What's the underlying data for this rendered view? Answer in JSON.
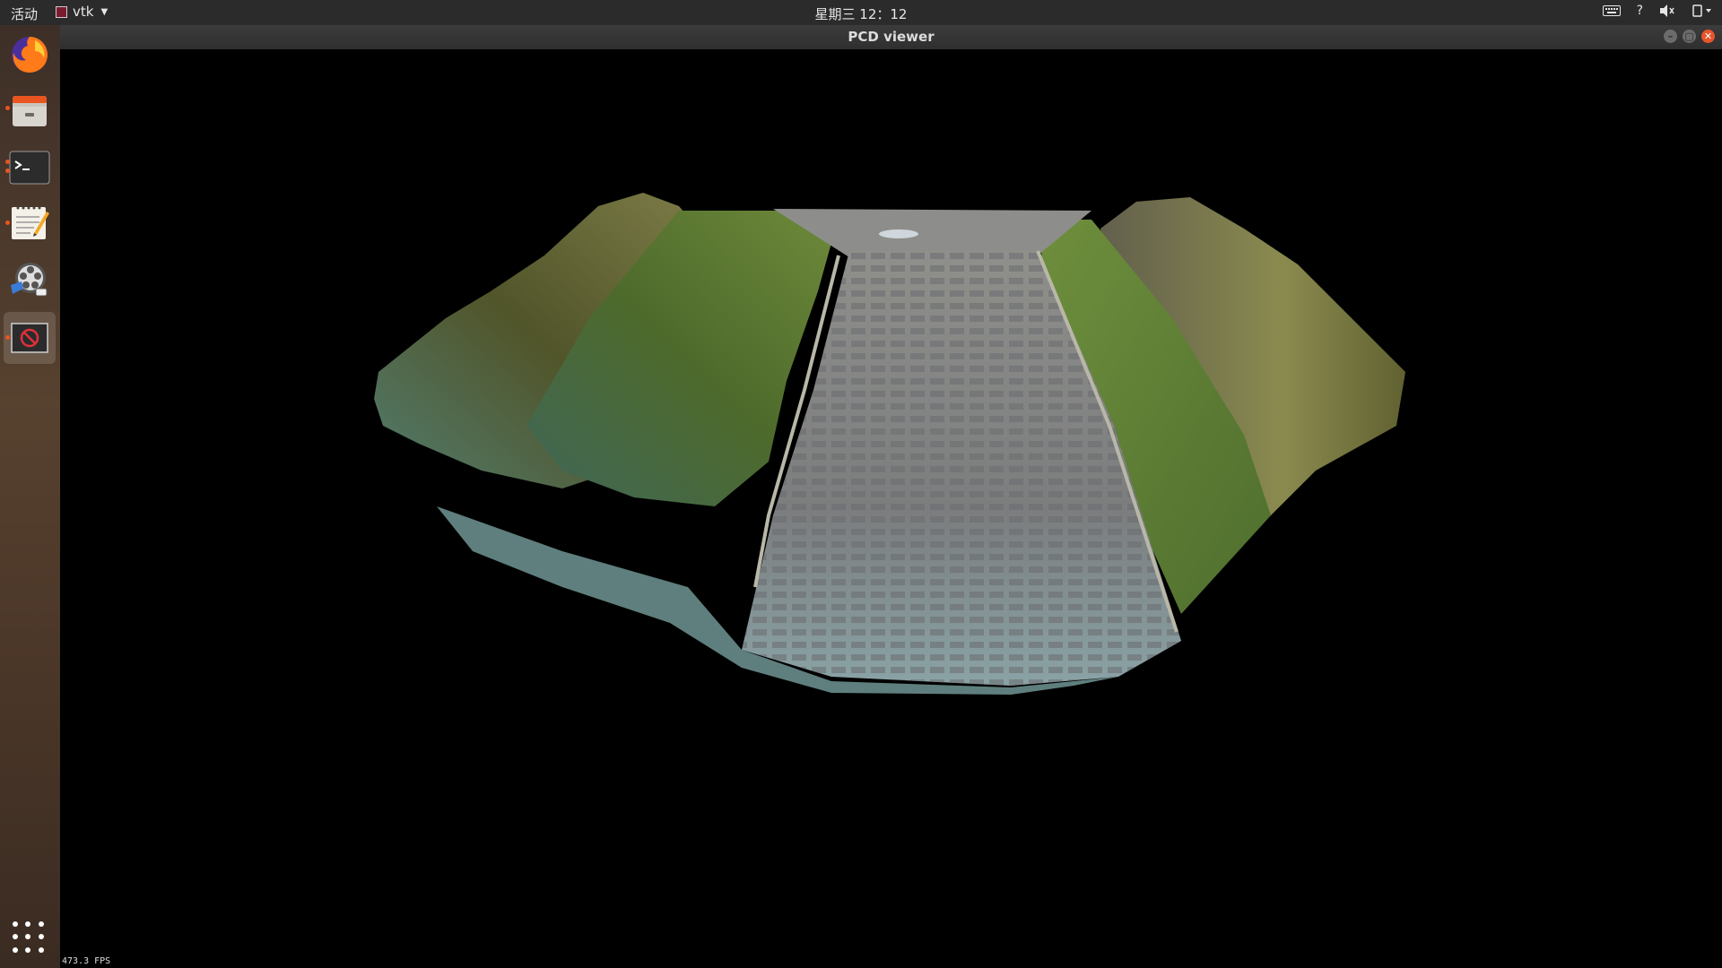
{
  "topbar": {
    "activities": "活动",
    "app_name": "vtk",
    "clock": "星期三 12：12",
    "tray": {
      "keyboard_icon": "keyboard-icon",
      "help": "?",
      "volume_icon": "volume-muted-icon",
      "power_icon": "power-icon"
    }
  },
  "window": {
    "title": "PCD viewer",
    "controls": {
      "minimize": "–",
      "maximize": "▢",
      "close": "✕"
    }
  },
  "dock": {
    "items": [
      {
        "name": "firefox",
        "icon": "firefox-icon",
        "running": false
      },
      {
        "name": "files",
        "icon": "files-icon",
        "running": true
      },
      {
        "name": "terminal",
        "icon": "terminal-icon",
        "running": true
      },
      {
        "name": "text-editor",
        "icon": "text-editor-icon",
        "running": true
      },
      {
        "name": "video-editor",
        "icon": "video-editor-icon",
        "running": false
      },
      {
        "name": "vtk-viewer",
        "icon": "vtk-app-icon",
        "running": true
      }
    ],
    "show_apps_icon": "grid-icon"
  },
  "viewer": {
    "content": "point-cloud",
    "fps_label": "473.3 FPS"
  },
  "colors": {
    "topbar_bg": "#2b2b2b",
    "titlebar_bg": "#333333",
    "accent": "#e95420",
    "viewport_bg": "#000000"
  }
}
